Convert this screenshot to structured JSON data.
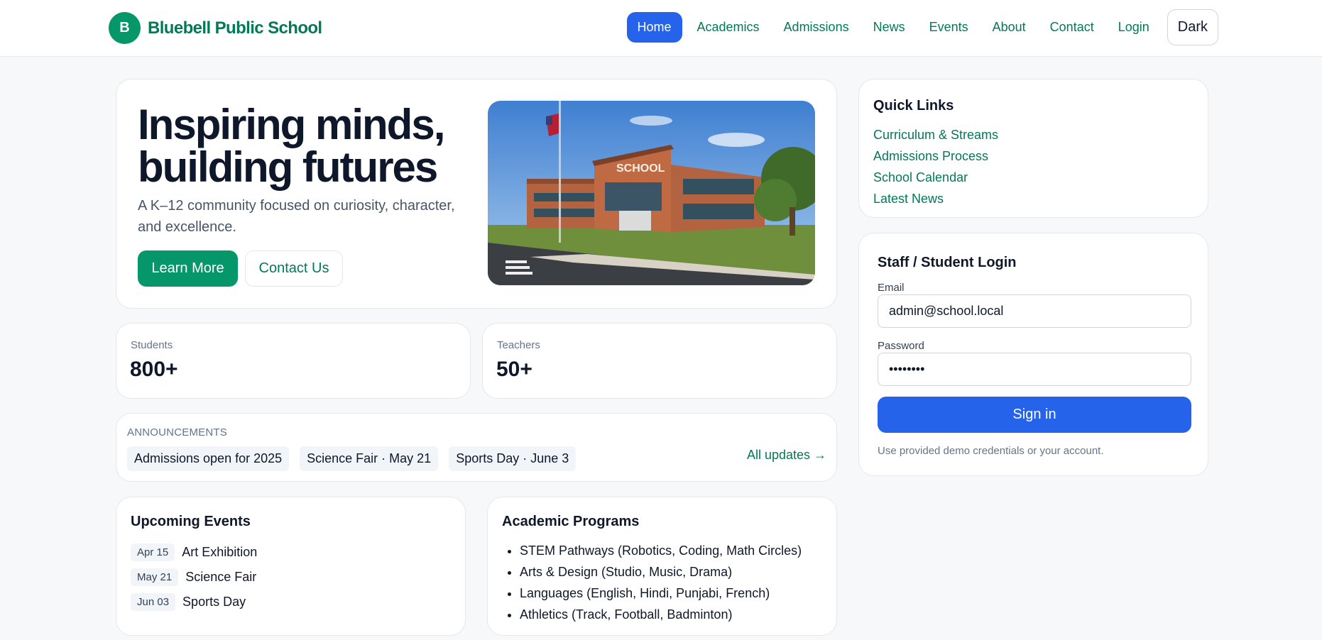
{
  "brand": {
    "logo_letter": "B",
    "name": "Bluebell Public School"
  },
  "nav": {
    "items": [
      {
        "label": "Home",
        "active": true
      },
      {
        "label": "Academics"
      },
      {
        "label": "Admissions"
      },
      {
        "label": "News"
      },
      {
        "label": "Events"
      },
      {
        "label": "About"
      },
      {
        "label": "Contact"
      },
      {
        "label": "Login"
      }
    ],
    "theme_toggle": "Dark"
  },
  "hero": {
    "title_line1": "Inspiring minds,",
    "title_line2": "building futures",
    "subtitle": "A K–12 community focused on curiosity, character, and excellence.",
    "primary_button": "Learn More",
    "secondary_button": "Contact Us",
    "image_sign": "SCHOOL"
  },
  "stats": [
    {
      "label": "Students",
      "value": "800+"
    },
    {
      "label": "Teachers",
      "value": "50+"
    }
  ],
  "announcements": {
    "label": "Announcements",
    "items": [
      "Admissions open for 2025",
      "Science Fair · May 21",
      "Sports Day · June 3"
    ],
    "all_link": "All updates →"
  },
  "events": {
    "title": "Upcoming Events",
    "items": [
      {
        "date": "Apr 15",
        "name": "Art Exhibition"
      },
      {
        "date": "May 21",
        "name": "Science Fair"
      },
      {
        "date": "Jun 03",
        "name": "Sports Day"
      }
    ]
  },
  "programs": {
    "title": "Academic Programs",
    "items": [
      "STEM Pathways (Robotics, Coding, Math Circles)",
      "Arts & Design (Studio, Music, Drama)",
      "Languages (English, Hindi, Punjabi, French)",
      "Athletics (Track, Football, Badminton)"
    ]
  },
  "quick_links": {
    "title": "Quick Links",
    "items": [
      "Curriculum & Streams",
      "Admissions Process",
      "School Calendar",
      "Latest News"
    ]
  },
  "login": {
    "title": "Staff / Student Login",
    "email_label": "Email",
    "email_value": "admin@school.local",
    "password_label": "Password",
    "password_value": "••••••••",
    "submit": "Sign in",
    "note": "Use provided demo credentials or your account."
  },
  "colors": {
    "brand_green": "#047857",
    "button_green": "#059669",
    "accent_blue": "#2563eb",
    "page_bg": "#f6f8fa"
  }
}
